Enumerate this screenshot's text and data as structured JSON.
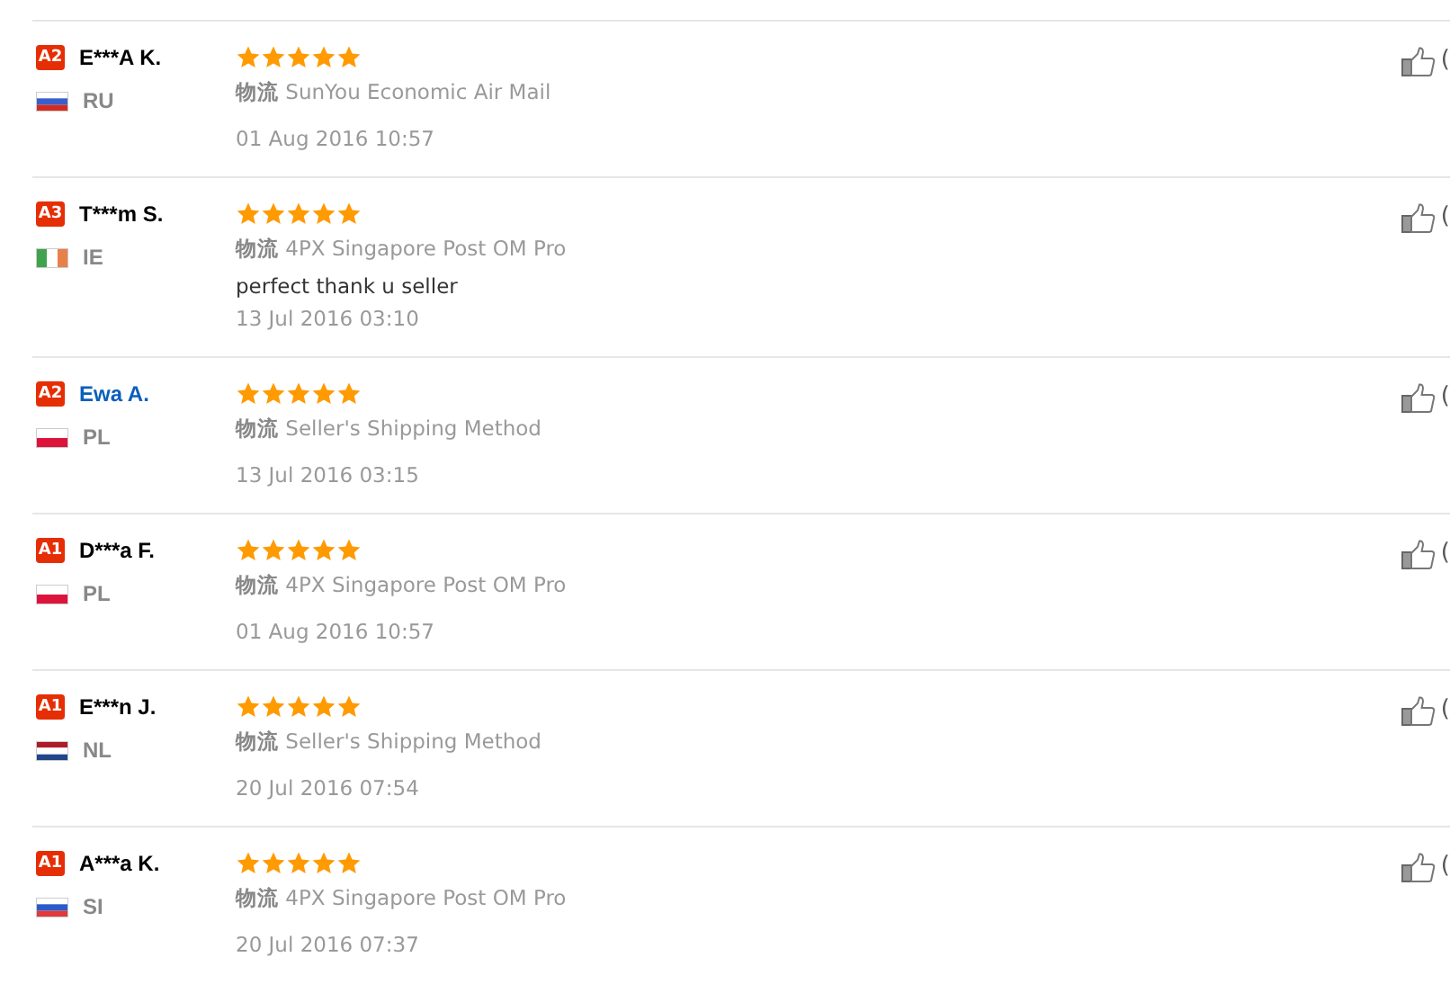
{
  "reviews": [
    {
      "badge": "A2",
      "name": "E***A K.",
      "name_link": false,
      "country": "RU",
      "kind": "ru",
      "stars": 5,
      "shipping_label": "物流",
      "shipping": "SunYou Economic Air Mail",
      "date": "01 Aug 2016 10:57",
      "helpful": "("
    },
    {
      "badge": "A3",
      "name": "T***m S.",
      "name_link": false,
      "country": "IE",
      "kind": "ie",
      "stars": 5,
      "shipping_label": "物流",
      "shipping": "4PX Singapore Post OM Pro",
      "comment": "perfect thank u seller",
      "date": "13 Jul 2016 03:10",
      "helpful": "("
    },
    {
      "badge": "A2",
      "name": "Ewa A.",
      "name_link": true,
      "country": "PL",
      "kind": "pl",
      "stars": 5,
      "shipping_label": "物流",
      "shipping": "Seller's Shipping Method",
      "date": "13 Jul 2016 03:15",
      "helpful": "("
    },
    {
      "badge": "A1",
      "name": "D***a F.",
      "name_link": false,
      "country": "PL",
      "kind": "pl",
      "stars": 5,
      "shipping_label": "物流",
      "shipping": "4PX Singapore Post OM Pro",
      "date": "01 Aug 2016 10:57",
      "helpful": "("
    },
    {
      "badge": "A1",
      "name": "E***n J.",
      "name_link": false,
      "country": "NL",
      "kind": "nl",
      "stars": 5,
      "shipping_label": "物流",
      "shipping": "Seller's Shipping Method",
      "date": "20 Jul 2016 07:54",
      "helpful": "("
    },
    {
      "badge": "A1",
      "name": "A***a K.",
      "name_link": false,
      "country": "SI",
      "kind": "si",
      "stars": 5,
      "shipping_label": "物流",
      "shipping": "4PX Singapore Post OM Pro",
      "date": "20 Jul 2016 07:37",
      "helpful": "("
    }
  ]
}
